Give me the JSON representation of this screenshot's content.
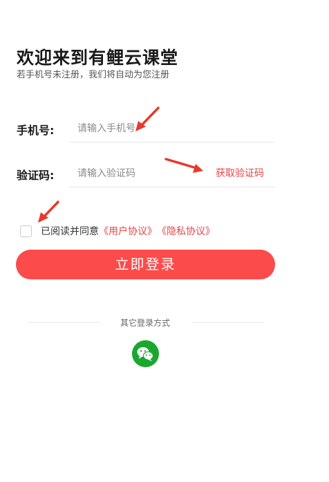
{
  "header": {
    "title": "欢迎来到有鲤云课堂",
    "subtitle": "若手机号未注册，我们将自动为您注册"
  },
  "form": {
    "phone_label": "手机号:",
    "phone_placeholder": "请输入手机号",
    "code_label": "验证码:",
    "code_placeholder": "请输入验证码",
    "get_code_label": "获取验证码"
  },
  "agreement": {
    "checked": false,
    "prefix": "已阅读并同意",
    "user_agreement": "《用户协议》",
    "privacy_policy": "《隐私协议》"
  },
  "login_button": "立即登录",
  "other_login": {
    "label": "其它登录方式",
    "icons": [
      "wechat-icon"
    ]
  },
  "annotations": {
    "arrow_color": "#e8392c",
    "icons": [
      "red-arrow-icon",
      "red-arrow-icon",
      "red-arrow-icon"
    ]
  },
  "colors": {
    "accent": "#fb4b4b",
    "link": "#e84545",
    "wechat": "#1aa72f"
  }
}
